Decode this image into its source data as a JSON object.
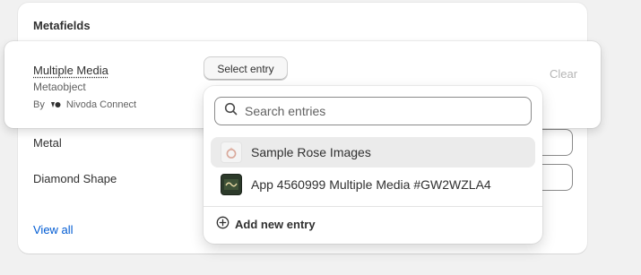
{
  "metafields": {
    "title": "Metafields",
    "rows": [
      {
        "label": "Metal"
      },
      {
        "label": "Diamond Shape"
      }
    ],
    "view_all": "View all"
  },
  "multiple_media": {
    "label": "Multiple Media",
    "type": "Metaobject",
    "by_prefix": "By",
    "provider": "Nivoda Connect",
    "provider_icon": "nivoda-logo-icon",
    "select_label": "Select entry",
    "clear_label": "Clear"
  },
  "dropdown": {
    "search": {
      "placeholder": "Search entries",
      "value": ""
    },
    "entries": [
      {
        "label": "Sample Rose Images",
        "icon": "ring-thumbnail",
        "selected": true
      },
      {
        "label": "App 4560999 Multiple Media #GW2WZLA4",
        "icon": "app-thumbnail",
        "selected": false
      }
    ],
    "add_new": "Add new entry"
  },
  "colors": {
    "link": "#005bd3",
    "text": "#303030",
    "muted": "#616161",
    "selected_bg": "#ebebeb"
  }
}
